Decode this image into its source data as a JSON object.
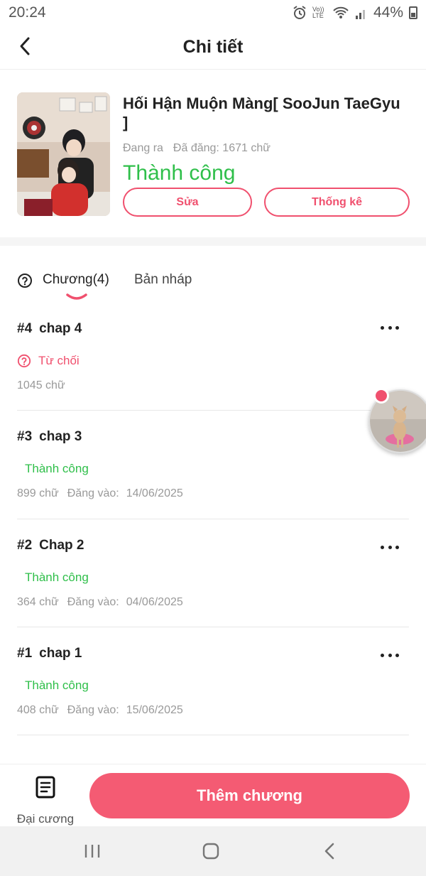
{
  "status_bar": {
    "time": "20:24",
    "volte": "Vo)) LTE",
    "battery_text": "44%"
  },
  "header": {
    "title": "Chi tiết"
  },
  "story": {
    "title": "Hối Hận Muộn Màng[ SooJun TaeGyu ]",
    "state": "Đang ra",
    "published": "Đã đăng: 1671 chữ",
    "status": "Thành công",
    "edit_label": "Sửa",
    "stats_label": "Thống kê"
  },
  "tabs": {
    "chapters_label": "Chương(4)",
    "drafts_label": "Bản nháp"
  },
  "chapters": [
    {
      "number": "#4",
      "title": "chap 4",
      "status": "Từ chối",
      "words": "1045 chữ",
      "posted_label": "",
      "date": ""
    },
    {
      "number": "#3",
      "title": "chap 3",
      "status": "Thành công",
      "words": "899 chữ",
      "posted_label": "Đăng vào:",
      "date": "14/06/2025"
    },
    {
      "number": "#2",
      "title": "Chap 2",
      "status": "Thành công",
      "words": "364 chữ",
      "posted_label": "Đăng vào:",
      "date": "04/06/2025"
    },
    {
      "number": "#1",
      "title": "chap 1",
      "status": "Thành công",
      "words": "408 chữ",
      "posted_label": "Đăng vào:",
      "date": "15/06/2025"
    }
  ],
  "bottom": {
    "outline_label": "Đại cương",
    "add_chapter_label": "Thêm chương"
  },
  "colors": {
    "accent": "#f0506e",
    "button": "#f45b73",
    "success": "#2fbf4a",
    "muted": "#999999"
  },
  "icons": [
    "back-arrow-icon",
    "help-circle-icon",
    "more-dots-icon",
    "outline-doc-icon",
    "recent-apps-icon",
    "home-icon",
    "nav-back-icon"
  ]
}
